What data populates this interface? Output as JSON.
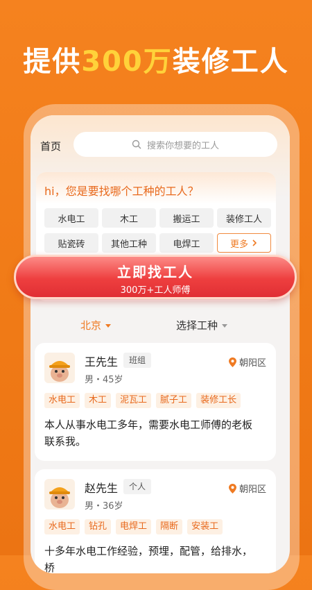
{
  "headline": {
    "prefix": "提供",
    "highlight": "300万",
    "suffix": "装修工人"
  },
  "nav": {
    "title": "首页",
    "search_placeholder": "搜索你想要的工人"
  },
  "panel": {
    "title": "hi，您是要找哪个工种的工人？",
    "chips": [
      "水电工",
      "木工",
      "搬运工",
      "装修工人",
      "贴瓷砖",
      "其他工种",
      "电焊工"
    ],
    "more": "更多"
  },
  "cta": {
    "main": "立即找工人",
    "sub": "300万+工人师傅"
  },
  "filters": {
    "city": "北京",
    "type": "选择工种"
  },
  "workers": [
    {
      "name": "王先生",
      "role": "班组",
      "location": "朝阳区",
      "meta": "男・45岁",
      "tags": [
        "水电工",
        "木工",
        "泥瓦工",
        "腻子工",
        "装修工长"
      ],
      "desc": "本人从事水电工多年，需要水电工师傅的老板联系我。"
    },
    {
      "name": "赵先生",
      "role": "个人",
      "location": "朝阳区",
      "meta": "男・36岁",
      "tags": [
        "水电工",
        "钻孔",
        "电焊工",
        "隔断",
        "安装工"
      ],
      "desc": "十多年水电工作经验，预埋，配管，给排水，桥"
    }
  ],
  "colors": {
    "brand_orange": "#f07a16",
    "accent_orange": "#ef7a22",
    "cta_red": "#ee3f3f",
    "highlight_yellow": "#ffd23a"
  }
}
